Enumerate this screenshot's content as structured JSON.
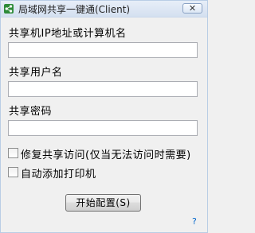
{
  "window": {
    "title": "局域网共享一键通(Client)",
    "close_label": "✕",
    "icon": "share-icon"
  },
  "form": {
    "host_label": "共享机IP地址或计算机名",
    "host_value": "",
    "user_label": "共享用户名",
    "user_value": "",
    "password_label": "共享密码",
    "password_value": ""
  },
  "options": {
    "repair_label": "修复共享访问(仅当无法访问时需要)",
    "repair_checked": false,
    "printer_label": "自动添加打印机",
    "printer_checked": false
  },
  "actions": {
    "start_label": "开始配置(S)",
    "help_label": "?"
  },
  "colors": {
    "icon_green": "#2e8b3a",
    "link_blue": "#0066cc"
  }
}
